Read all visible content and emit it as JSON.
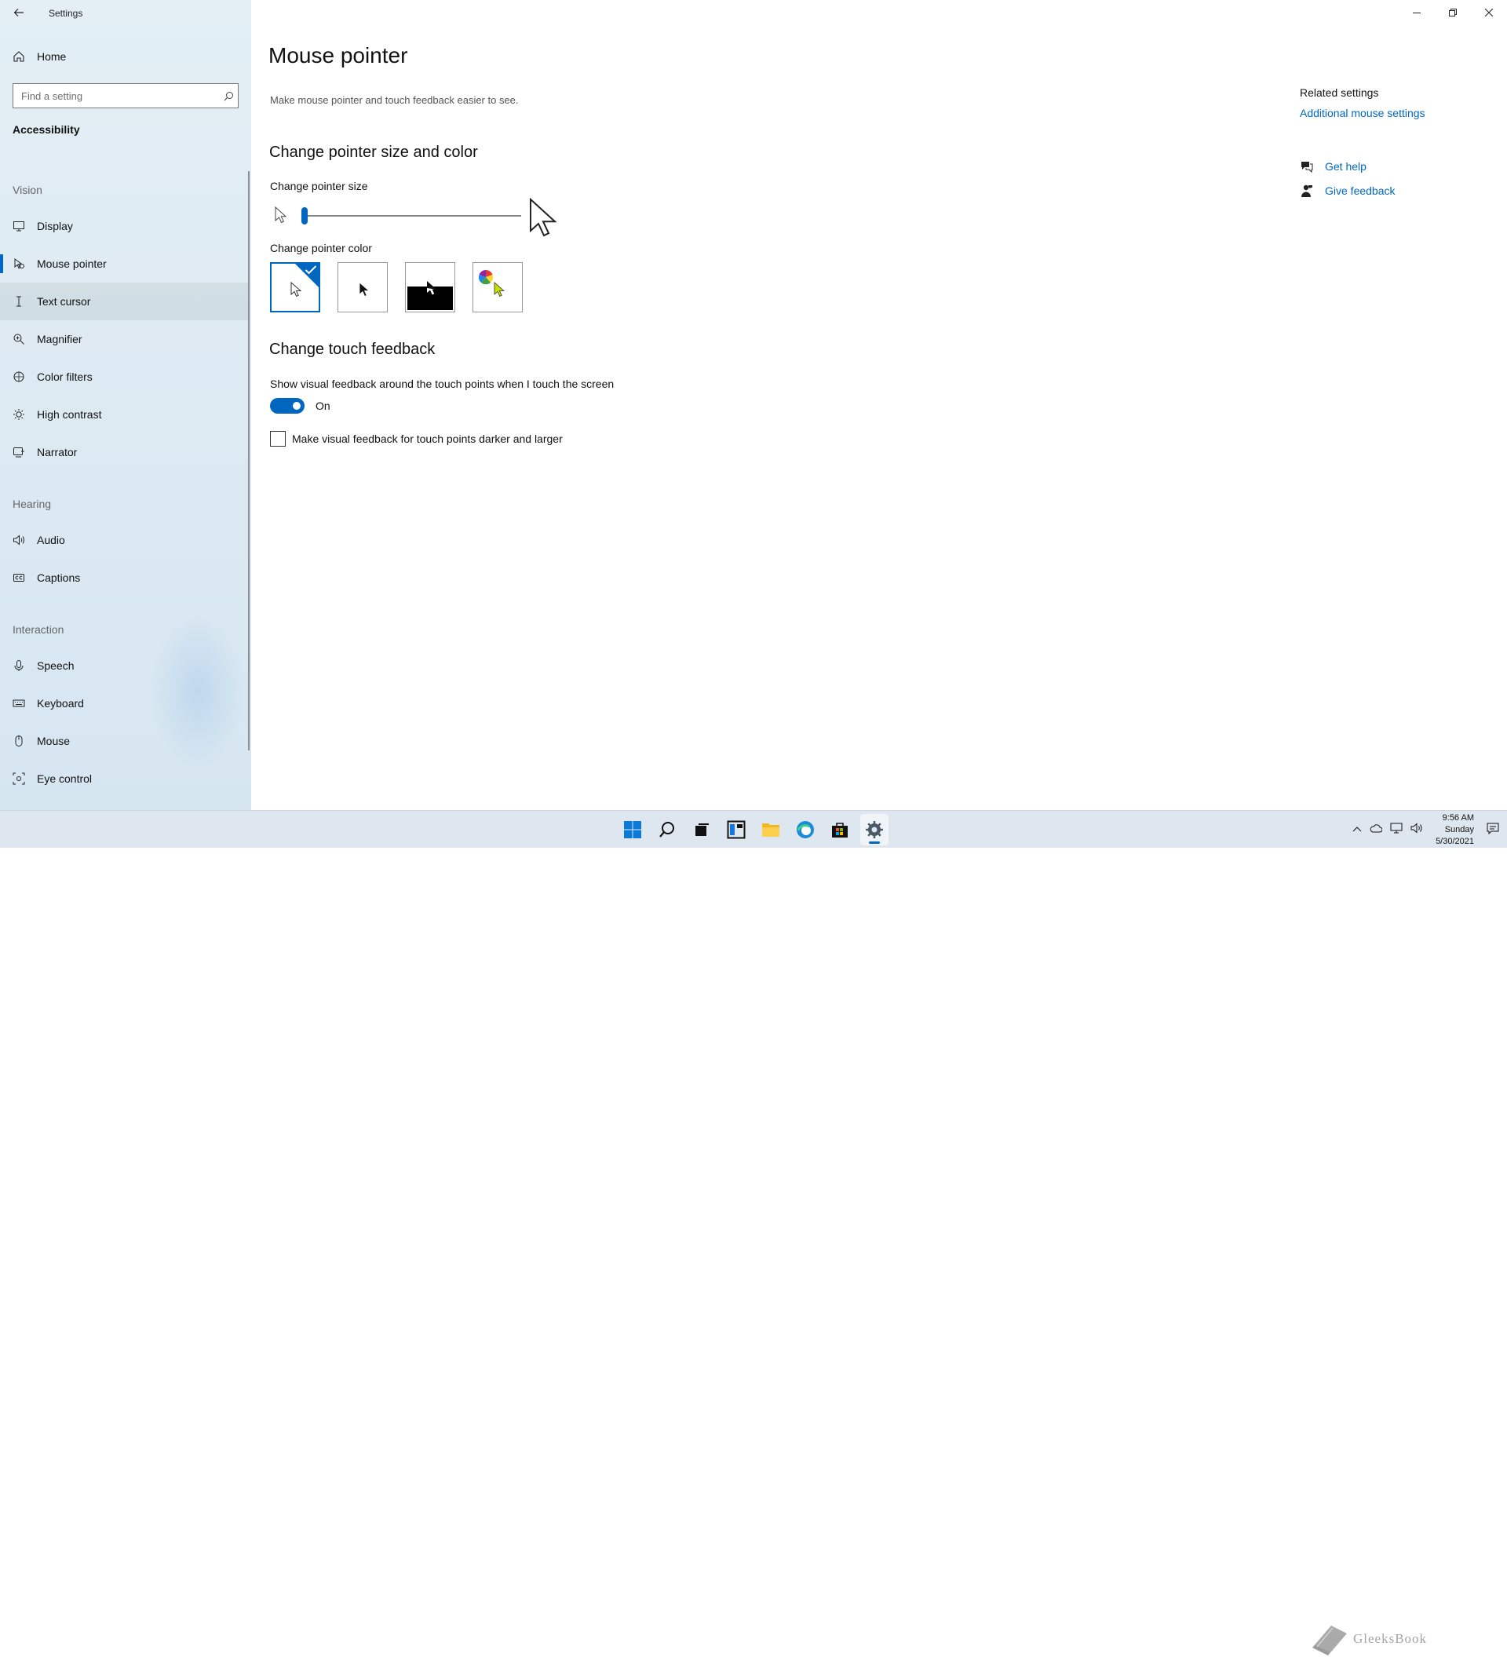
{
  "app": {
    "title": "Settings"
  },
  "sidebar": {
    "home": "Home",
    "search_placeholder": "Find a setting",
    "section": "Accessibility",
    "groups": [
      {
        "label": "Vision",
        "items": [
          "Display",
          "Mouse pointer",
          "Text cursor",
          "Magnifier",
          "Color filters",
          "High contrast",
          "Narrator"
        ]
      },
      {
        "label": "Hearing",
        "items": [
          "Audio",
          "Captions"
        ]
      },
      {
        "label": "Interaction",
        "items": [
          "Speech",
          "Keyboard",
          "Mouse",
          "Eye control"
        ]
      }
    ],
    "selected": "Mouse pointer"
  },
  "main": {
    "title": "Mouse pointer",
    "description": "Make mouse pointer and touch feedback easier to see.",
    "size_color": {
      "heading": "Change pointer size and color",
      "size_label": "Change pointer size",
      "size_value": 1,
      "size_max": 15,
      "color_label": "Change pointer color",
      "color_options": [
        "white",
        "black",
        "inverted",
        "custom"
      ],
      "selected_color": "white"
    },
    "touch": {
      "heading": "Change touch feedback",
      "toggle_label": "Show visual feedback around the touch points when I touch the screen",
      "toggle_state": "On",
      "checkbox_label": "Make visual feedback for touch points darker and larger",
      "checkbox_checked": false
    }
  },
  "related": {
    "title": "Related settings",
    "link": "Additional mouse settings",
    "help": "Get help",
    "feedback": "Give feedback"
  },
  "taskbar": {
    "time": "9:56 AM",
    "day": "Sunday",
    "date": "5/30/2021"
  },
  "watermark": "GleeksBook",
  "colors": {
    "accent": "#0067c0",
    "sidebar_bg": "#e3eef5"
  }
}
